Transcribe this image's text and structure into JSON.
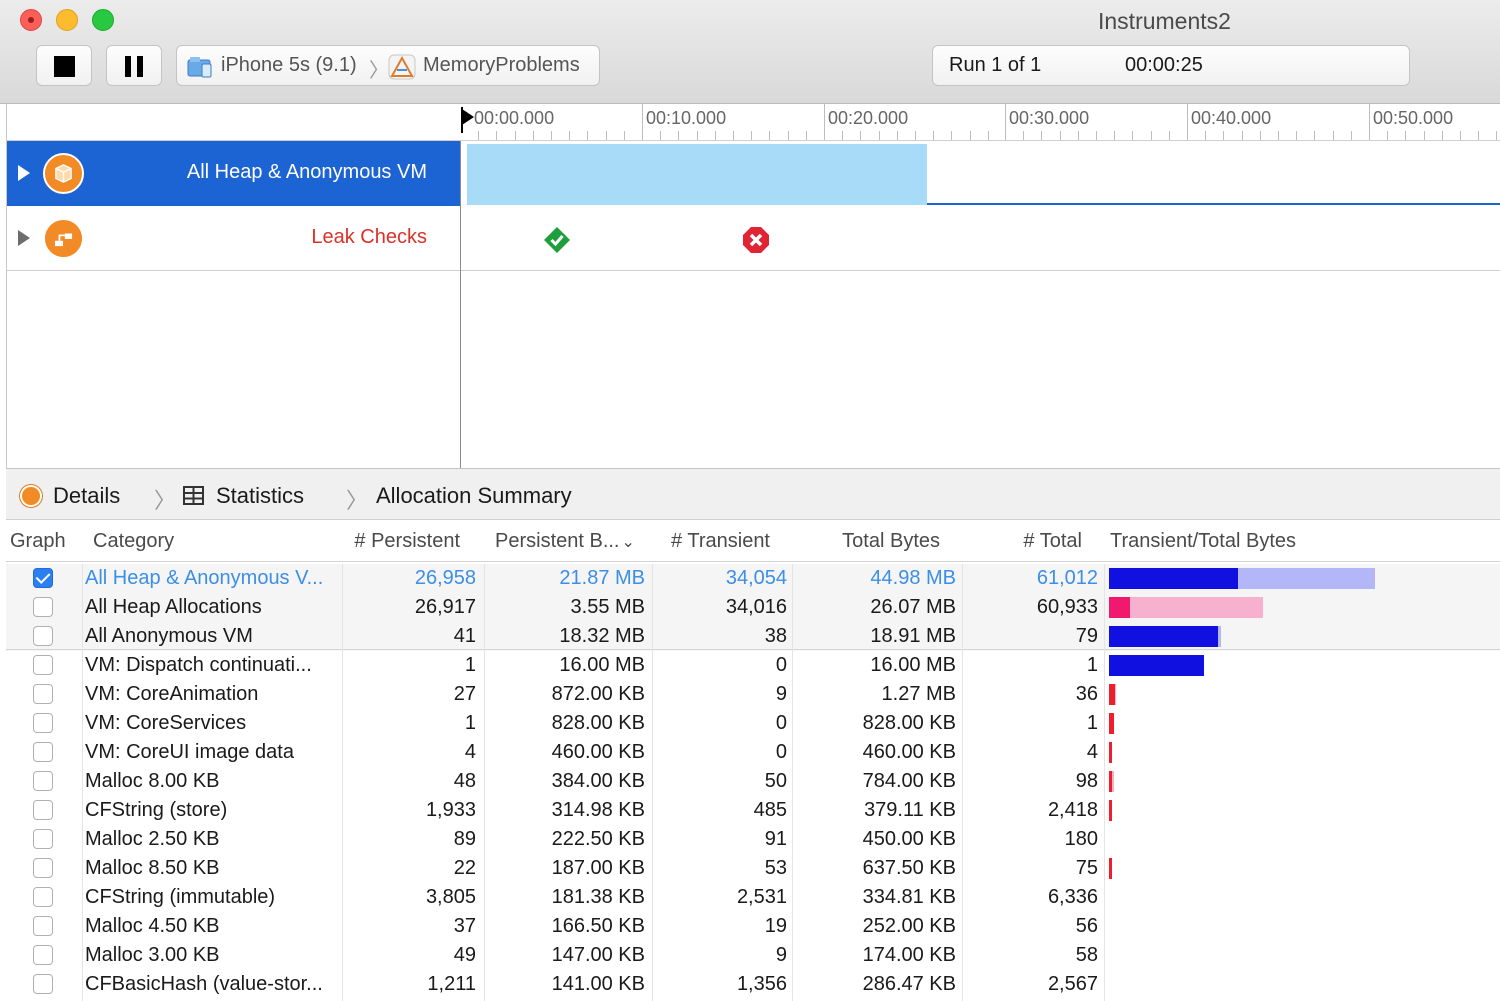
{
  "window": {
    "title": "Instruments2"
  },
  "toolbar": {
    "device": "iPhone 5s (9.1)",
    "app": "MemoryProblems",
    "run": "Run 1 of 1",
    "elapsed": "00:00:25"
  },
  "ruler": {
    "labels": [
      "00:00.000",
      "00:10.000",
      "00:20.000",
      "00:30.000",
      "00:40.000",
      "00:50.000"
    ]
  },
  "tracks": [
    {
      "name": "All Heap & Anonymous VM",
      "selected": true,
      "icon": "allocations-icon",
      "color": "#1c63d3"
    },
    {
      "name": "Leak Checks",
      "selected": false,
      "icon": "leaks-icon",
      "color": "#dc3128",
      "checks": [
        "passed",
        "leaked"
      ]
    }
  ],
  "jumpbar": {
    "details": "Details",
    "statistics": "Statistics",
    "summary": "Allocation Summary"
  },
  "table": {
    "columns": [
      "Graph",
      "Category",
      "# Persistent",
      "Persistent B...",
      "# Transient",
      "Total Bytes",
      "# Total",
      "Transient/Total Bytes"
    ],
    "rows": [
      {
        "checked": true,
        "category": "All Heap & Anonymous V...",
        "persistent": "26,958",
        "persistent_bytes": "21.87 MB",
        "transient": "34,054",
        "total_bytes": "44.98 MB",
        "total": "61,012",
        "bar": {
          "persistent_frac": 0.486,
          "total_frac": 1.0,
          "color": "#1010e0",
          "light": "#b3b6f7"
        }
      },
      {
        "checked": false,
        "category": "All Heap Allocations",
        "persistent": "26,917",
        "persistent_bytes": "3.55 MB",
        "transient": "34,016",
        "total_bytes": "26.07 MB",
        "total": "60,933",
        "bar": {
          "persistent_frac": 0.136,
          "total_frac": 0.58,
          "color": "#f0196d",
          "light": "#f7b1cf"
        }
      },
      {
        "checked": false,
        "category": "All Anonymous VM",
        "persistent": "41",
        "persistent_bytes": "18.32 MB",
        "transient": "38",
        "total_bytes": "18.91 MB",
        "total": "79",
        "bar": {
          "persistent_frac": 0.969,
          "total_frac": 0.42,
          "color": "#1010e0",
          "light": "#b3b6f7"
        }
      },
      {
        "checked": false,
        "category": "VM: Dispatch continuati...",
        "persistent": "1",
        "persistent_bytes": "16.00 MB",
        "transient": "0",
        "total_bytes": "16.00 MB",
        "total": "1",
        "bar": {
          "persistent_frac": 1.0,
          "total_frac": 0.356,
          "color": "#1010e0",
          "light": "#b3b6f7"
        }
      },
      {
        "checked": false,
        "category": "VM: CoreAnimation",
        "persistent": "27",
        "persistent_bytes": "872.00 KB",
        "transient": "9",
        "total_bytes": "1.27 MB",
        "total": "36",
        "bar": {
          "persistent_frac": 0.8,
          "total_frac": 0.028,
          "color": "#ef1e2e",
          "light": "#f6b3ba"
        }
      },
      {
        "checked": false,
        "category": "VM: CoreServices",
        "persistent": "1",
        "persistent_bytes": "828.00 KB",
        "transient": "0",
        "total_bytes": "828.00 KB",
        "total": "1",
        "bar": {
          "persistent_frac": 1.0,
          "total_frac": 0.018,
          "color": "#ef1e2e",
          "light": "#f6b3ba"
        }
      },
      {
        "checked": false,
        "category": "VM: CoreUI image data",
        "persistent": "4",
        "persistent_bytes": "460.00 KB",
        "transient": "0",
        "total_bytes": "460.00 KB",
        "total": "4",
        "bar": {
          "persistent_frac": 1.0,
          "total_frac": 0.011,
          "color": "#ef1e2e",
          "light": "#f6b3ba"
        }
      },
      {
        "checked": false,
        "category": "Malloc 8.00 KB",
        "persistent": "48",
        "persistent_bytes": "384.00 KB",
        "transient": "50",
        "total_bytes": "784.00 KB",
        "total": "98",
        "bar": {
          "persistent_frac": 0.49,
          "total_frac": 0.017,
          "color": "#ef1e2e",
          "light": "#f6b3ba"
        }
      },
      {
        "checked": false,
        "category": "CFString (store)",
        "persistent": "1,933",
        "persistent_bytes": "314.98 KB",
        "transient": "485",
        "total_bytes": "379.11 KB",
        "total": "2,418",
        "bar": {
          "persistent_frac": 0.83,
          "total_frac": 0.009,
          "color": "#ef1e2e",
          "light": "#f6b3ba"
        }
      },
      {
        "checked": false,
        "category": "Malloc 2.50 KB",
        "persistent": "89",
        "persistent_bytes": "222.50 KB",
        "transient": "91",
        "total_bytes": "450.00 KB",
        "total": "180",
        "bar": {
          "persistent_frac": 0.49,
          "total_frac": 0.0,
          "color": "#ef1e2e",
          "light": "#f6b3ba"
        }
      },
      {
        "checked": false,
        "category": "Malloc 8.50 KB",
        "persistent": "22",
        "persistent_bytes": "187.00 KB",
        "transient": "53",
        "total_bytes": "637.50 KB",
        "total": "75",
        "bar": {
          "persistent_frac": 0.29,
          "total_frac": 0.008,
          "color": "#ef1e2e",
          "light": "#f6b3ba"
        }
      },
      {
        "checked": false,
        "category": "CFString (immutable)",
        "persistent": "3,805",
        "persistent_bytes": "181.38 KB",
        "transient": "2,531",
        "total_bytes": "334.81 KB",
        "total": "6,336",
        "bar": {
          "persistent_frac": 0.54,
          "total_frac": 0.0,
          "color": "#ef1e2e",
          "light": "#f6b3ba"
        }
      },
      {
        "checked": false,
        "category": "Malloc 4.50 KB",
        "persistent": "37",
        "persistent_bytes": "166.50 KB",
        "transient": "19",
        "total_bytes": "252.00 KB",
        "total": "56",
        "bar": {
          "persistent_frac": 0.66,
          "total_frac": 0.0,
          "color": "#ef1e2e",
          "light": "#f6b3ba"
        }
      },
      {
        "checked": false,
        "category": "Malloc 3.00 KB",
        "persistent": "49",
        "persistent_bytes": "147.00 KB",
        "transient": "9",
        "total_bytes": "174.00 KB",
        "total": "58",
        "bar": {
          "persistent_frac": 0.84,
          "total_frac": 0.0,
          "color": "#ef1e2e",
          "light": "#f6b3ba"
        }
      },
      {
        "checked": false,
        "category": "CFBasicHash (value-stor...",
        "persistent": "1,211",
        "persistent_bytes": "141.00 KB",
        "transient": "1,356",
        "total_bytes": "286.47 KB",
        "total": "2,567",
        "bar": {
          "persistent_frac": 0.49,
          "total_frac": 0.0,
          "color": "#ef1e2e",
          "light": "#f6b3ba"
        }
      }
    ]
  }
}
